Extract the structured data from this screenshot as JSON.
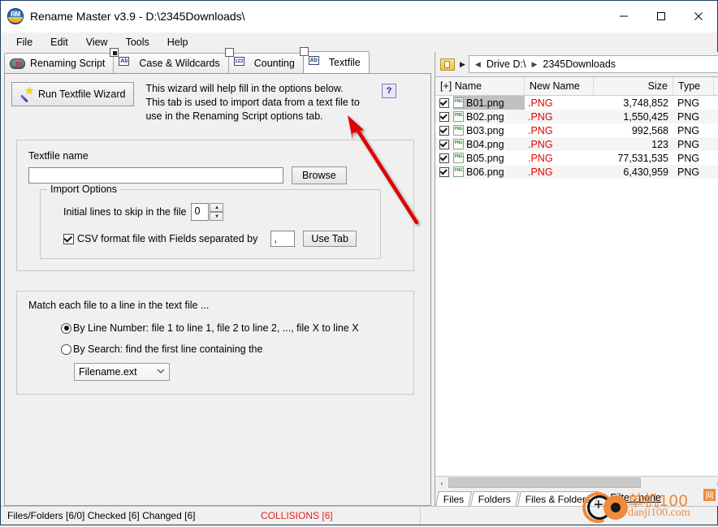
{
  "window": {
    "title": "Rename Master v3.9 - D:\\2345Downloads\\",
    "app_icon": "rm-app-icon",
    "minimize": "—",
    "maximize": "□",
    "close": "✕"
  },
  "menu": {
    "items": [
      {
        "label": "File"
      },
      {
        "label": "Edit"
      },
      {
        "label": "View"
      },
      {
        "label": "Tools"
      },
      {
        "label": "Help"
      }
    ]
  },
  "tabs": [
    {
      "label": "Renaming Script",
      "icon": "script-icon",
      "active": false
    },
    {
      "label": "Case & Wildcards",
      "icon": "ab-docs-icon",
      "active": false
    },
    {
      "label": "Counting",
      "icon": "123-docs-icon",
      "active": false
    },
    {
      "label": "Textfile",
      "icon": "ab-docs-icon",
      "active": true
    }
  ],
  "tab_icon_labels": {
    "case": "Ab",
    "counting": "123",
    "textfile": "Ab"
  },
  "textfile_tab": {
    "wizard_button": "Run Textfile Wizard",
    "wizard_description": "This wizard will help fill in the options below. This tab is used to import data from a text file to use in the Renaming Script options tab.",
    "help_button": "?",
    "textfile_name_label": "Textfile name",
    "textfile_name_value": "",
    "textfile_name_placeholder": "",
    "browse_button": "Browse",
    "import_options": {
      "legend": "Import Options",
      "skip_lines_label": "Initial lines to skip in the file",
      "skip_lines_value": "0",
      "spin_up": "▲",
      "spin_down": "▼",
      "csv_checkbox_label": "CSV format file with Fields separated by",
      "csv_checked": true,
      "separator_value": ",",
      "use_tab_button": "Use Tab"
    },
    "match_section": {
      "heading": "Match each file to a line in the text file  ...",
      "option_line_number": "By Line Number:   file 1 to line 1, file 2 to line 2, ..., file X to line X",
      "option_line_number_selected": true,
      "option_search": "By Search: find the first line containing the",
      "option_search_selected": false,
      "search_field_selected": "Filename.ext",
      "search_field_chevron": "⌄"
    }
  },
  "annotation": {
    "arrow_color": "#e00000",
    "points_to": "textfile-tab"
  },
  "file_panel": {
    "nav": {
      "folder_icon": "folder-hand-icon",
      "play_icon": "▶",
      "back_icon": "◀",
      "crumb_separator": "▶",
      "breadcrumbs": [
        "Drive D:\\",
        "2345Downloads"
      ]
    },
    "columns": [
      {
        "label": "[+] Name"
      },
      {
        "label": "New Name"
      },
      {
        "label": "Size"
      },
      {
        "label": "Type"
      },
      {
        "label": ""
      }
    ],
    "rows": [
      {
        "checked": true,
        "icon": "png-file-icon",
        "name": "B01.png",
        "new_name": ".PNG",
        "size": "3,748,852",
        "type": "PNG",
        "selected": true
      },
      {
        "checked": true,
        "icon": "png-file-icon",
        "name": "B02.png",
        "new_name": ".PNG",
        "size": "1,550,425",
        "type": "PNG",
        "selected": false
      },
      {
        "checked": true,
        "icon": "png-file-icon",
        "name": "B03.png",
        "new_name": ".PNG",
        "size": "992,568",
        "type": "PNG",
        "selected": false
      },
      {
        "checked": true,
        "icon": "png-file-icon",
        "name": "B04.png",
        "new_name": ".PNG",
        "size": "123",
        "type": "PNG",
        "selected": false
      },
      {
        "checked": true,
        "icon": "png-file-icon",
        "name": "B05.png",
        "new_name": ".PNG",
        "size": "77,531,535",
        "type": "PNG",
        "selected": false
      },
      {
        "checked": true,
        "icon": "png-file-icon",
        "name": "B06.png",
        "new_name": ".PNG",
        "size": "6,430,959",
        "type": "PNG",
        "selected": false
      }
    ],
    "hscroll": {
      "left_arrow": "‹",
      "right_arrow": "›"
    },
    "bottom_tabs": [
      {
        "label": "Files"
      },
      {
        "label": "Folders"
      },
      {
        "label": "Files & Folders"
      }
    ],
    "filter_label": "Filter: none"
  },
  "status_bar": {
    "left": "Files/Folders [6/0] Checked [6] Changed [6]",
    "collisions": "COLLISIONS [6]",
    "right": ""
  },
  "watermark": {
    "line1": "单机100",
    "badge": "网",
    "line2": "danji100.com",
    "color": "#f08a3c"
  }
}
